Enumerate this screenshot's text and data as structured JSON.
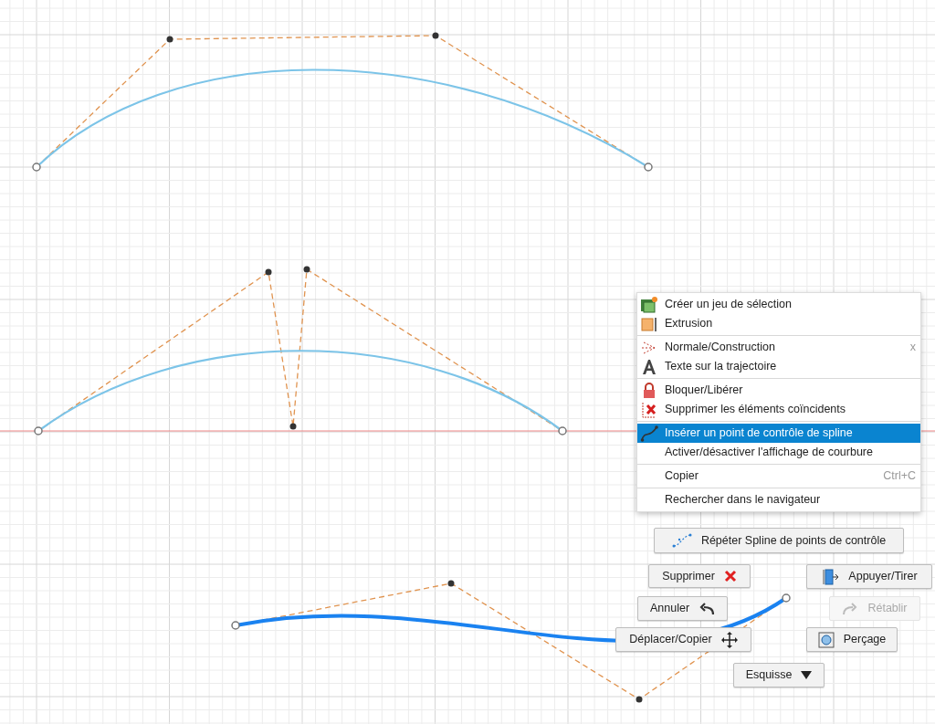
{
  "context_menu": {
    "groups": [
      {
        "items": [
          {
            "label": "Créer un jeu de sélection",
            "selected": false
          },
          {
            "label": "Extrusion",
            "selected": false
          }
        ]
      },
      {
        "items": [
          {
            "label": "Normale/Construction",
            "shortcut": "x",
            "selected": false
          },
          {
            "label": "Texte sur la trajectoire",
            "selected": false
          }
        ]
      },
      {
        "items": [
          {
            "label": "Bloquer/Libérer",
            "selected": false
          },
          {
            "label": "Supprimer les éléments coïncidents",
            "selected": false
          }
        ]
      },
      {
        "items": [
          {
            "label": "Insérer un point de contrôle de spline",
            "selected": true
          },
          {
            "label": "Activer/désactiver l'affichage de courbure",
            "selected": false
          }
        ]
      },
      {
        "items": [
          {
            "label": "Copier",
            "shortcut": "Ctrl+C",
            "selected": false
          }
        ]
      },
      {
        "items": [
          {
            "label": "Rechercher dans le navigateur",
            "selected": false
          }
        ]
      }
    ]
  },
  "marking_menu": [
    {
      "label": "Répéter Spline de points de contrôle",
      "disabled": false
    },
    {
      "label": "Supprimer",
      "disabled": false
    },
    {
      "label": "Appuyer/Tirer",
      "disabled": false
    },
    {
      "label": "Annuler",
      "disabled": false
    },
    {
      "label": "Rétablir",
      "disabled": true
    },
    {
      "label": "Déplacer/Copier",
      "disabled": false
    },
    {
      "label": "Perçage",
      "disabled": false
    },
    {
      "label": "Esquisse",
      "disabled": false
    }
  ]
}
